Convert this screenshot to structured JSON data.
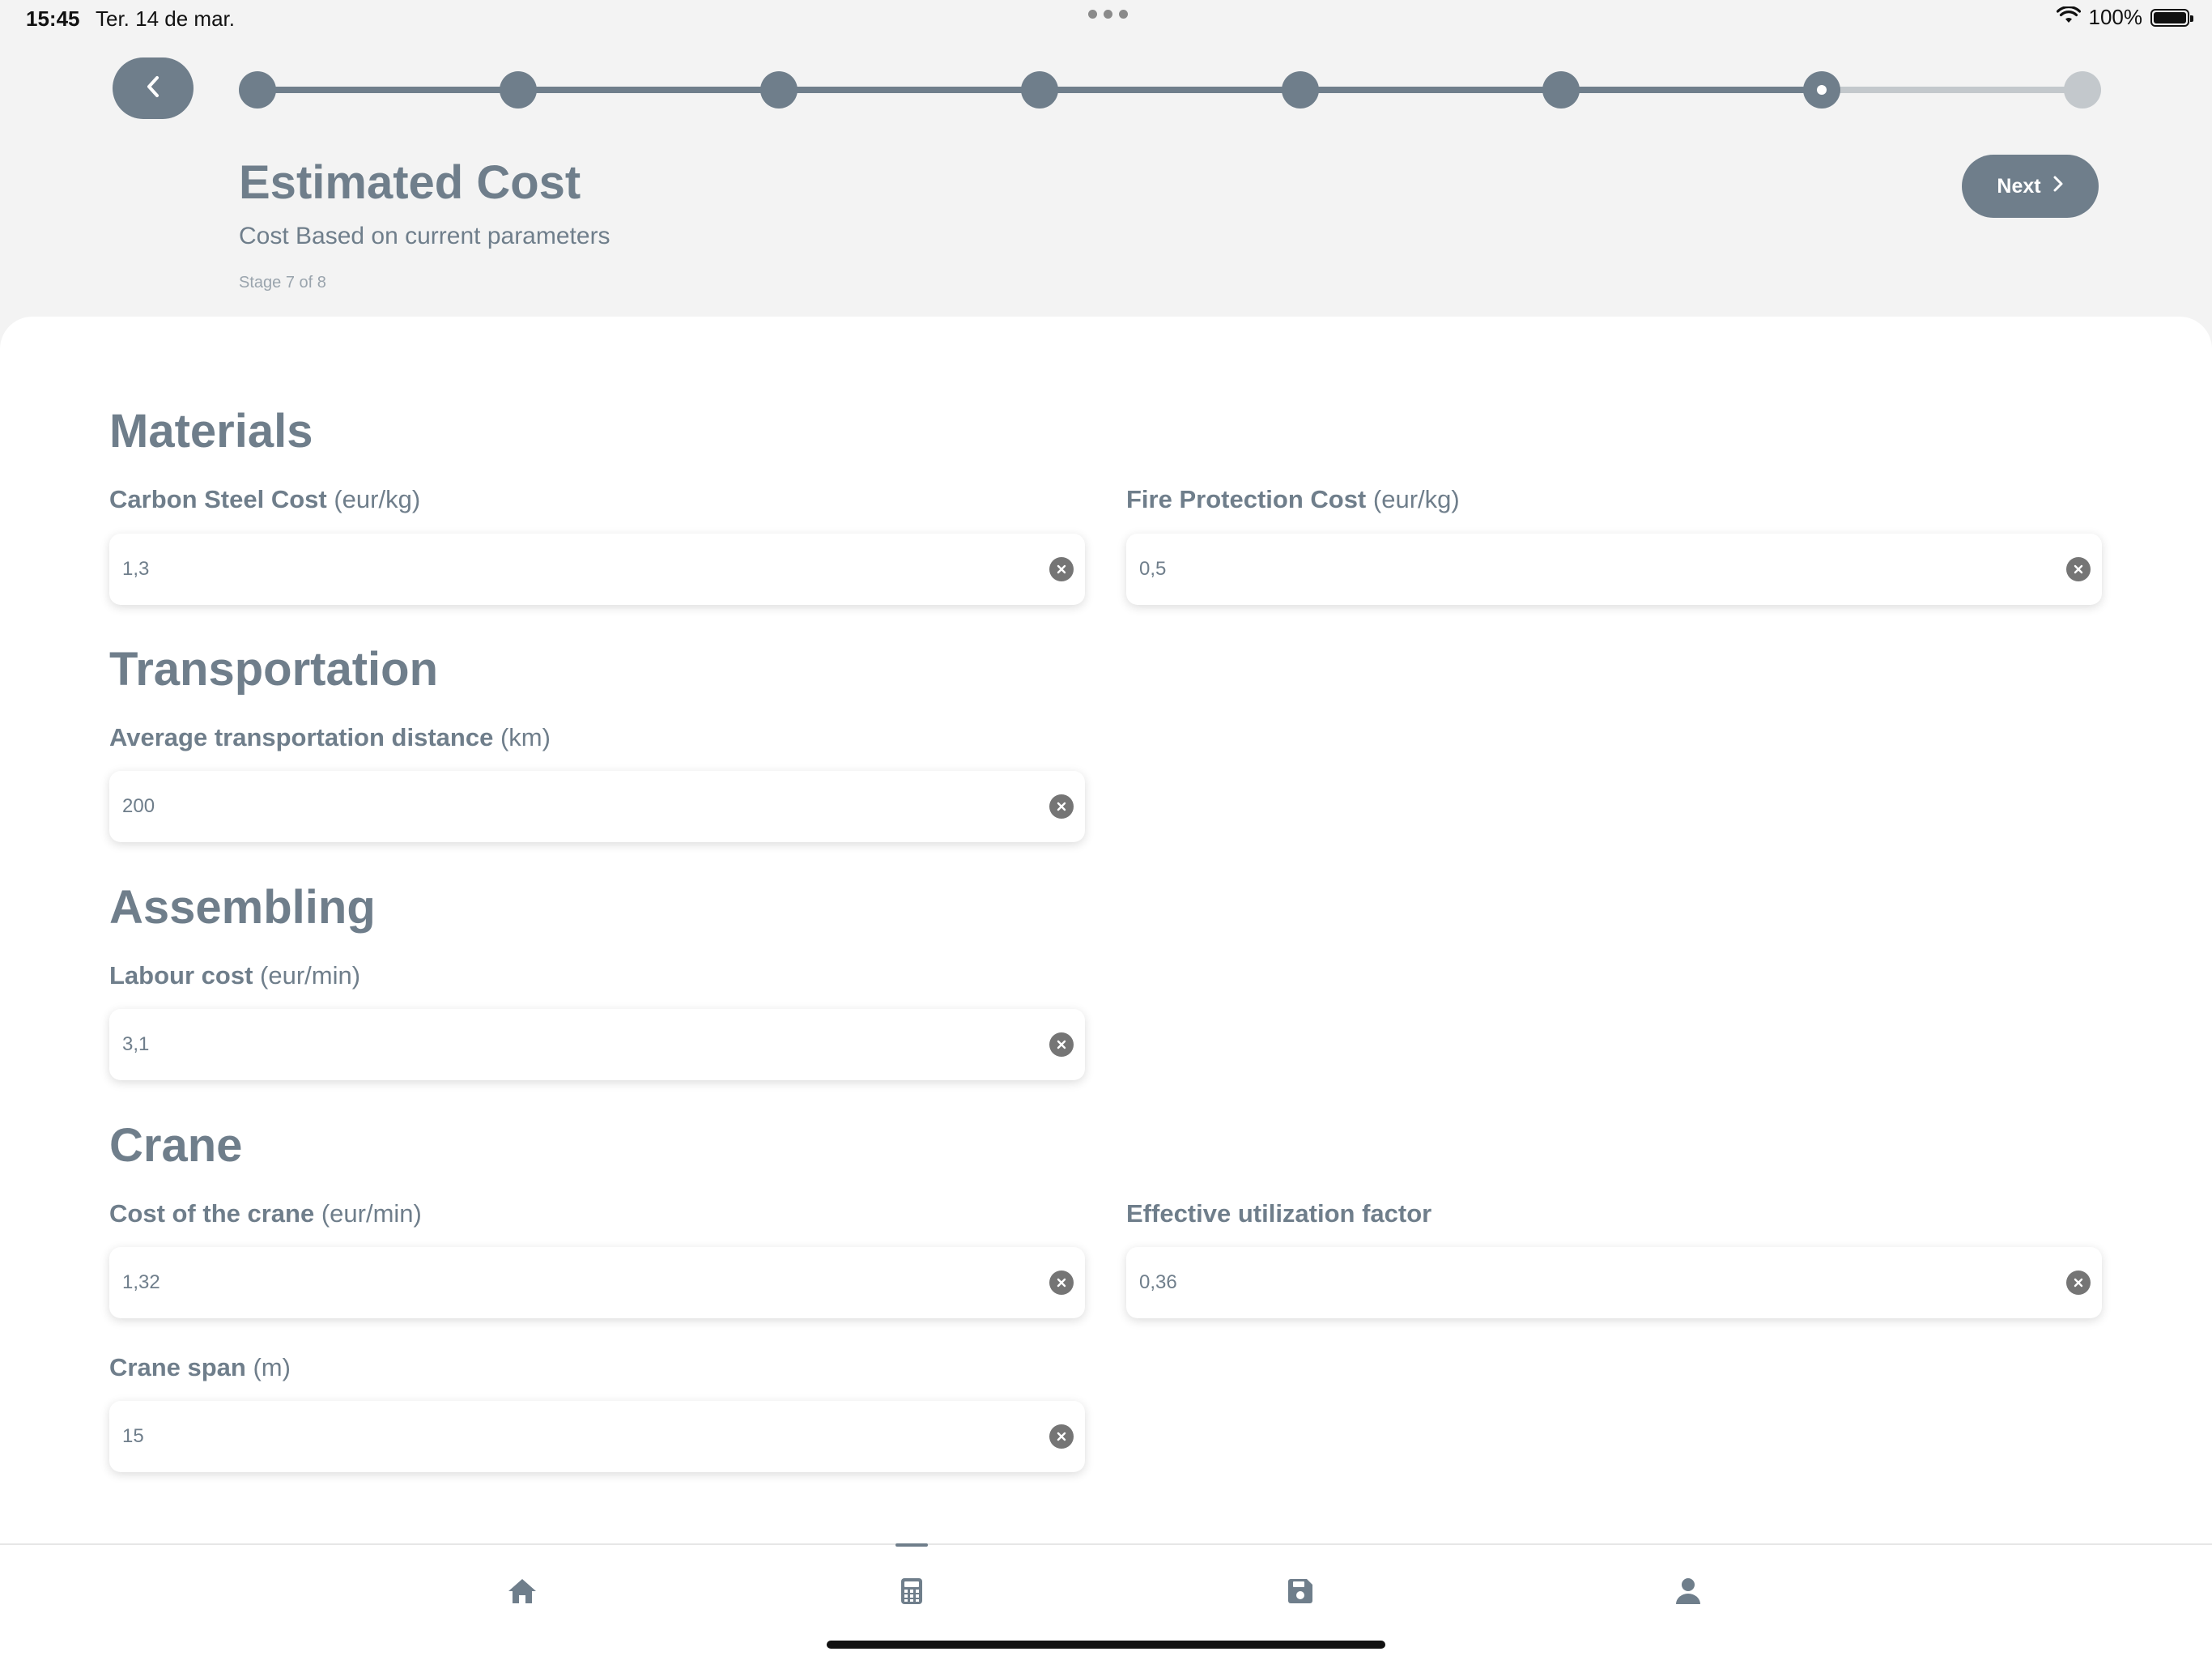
{
  "status_bar": {
    "time": "15:45",
    "date": "Ter. 14 de mar.",
    "battery": "100%"
  },
  "header": {
    "title": "Estimated Cost",
    "subtitle": "Cost Based on current parameters",
    "stage_text": "Stage 7 of 8",
    "next_label": "Next",
    "stepper": {
      "total_steps": 8,
      "current_step": 7
    }
  },
  "sections": {
    "materials": {
      "title": "Materials",
      "carbon_steel": {
        "label": "Carbon Steel Cost",
        "unit": "(eur/kg)",
        "value": "1,3"
      },
      "fire_protection": {
        "label": "Fire Protection Cost",
        "unit": "(eur/kg)",
        "value": "0,5"
      }
    },
    "transportation": {
      "title": "Transportation",
      "distance": {
        "label": "Average transportation distance",
        "unit": "(km)",
        "value": "200"
      }
    },
    "assembling": {
      "title": "Assembling",
      "labour": {
        "label": "Labour cost",
        "unit": "(eur/min)",
        "value": "3,1"
      }
    },
    "crane": {
      "title": "Crane",
      "crane_cost": {
        "label": "Cost of the crane",
        "unit": "(eur/min)",
        "value": "1,32"
      },
      "utilization": {
        "label": "Effective utilization factor",
        "unit": "",
        "value": "0,36"
      },
      "span": {
        "label": "Crane span",
        "unit": "(m)",
        "value": "15"
      }
    }
  },
  "tabbar": {
    "items": [
      {
        "icon": "home-icon"
      },
      {
        "icon": "calculator-icon",
        "active": true
      },
      {
        "icon": "save-icon"
      },
      {
        "icon": "person-icon"
      }
    ]
  },
  "colors": {
    "primary": "#6f7e8b",
    "pending": "#c3c8cc",
    "background": "#f3f3f3"
  }
}
